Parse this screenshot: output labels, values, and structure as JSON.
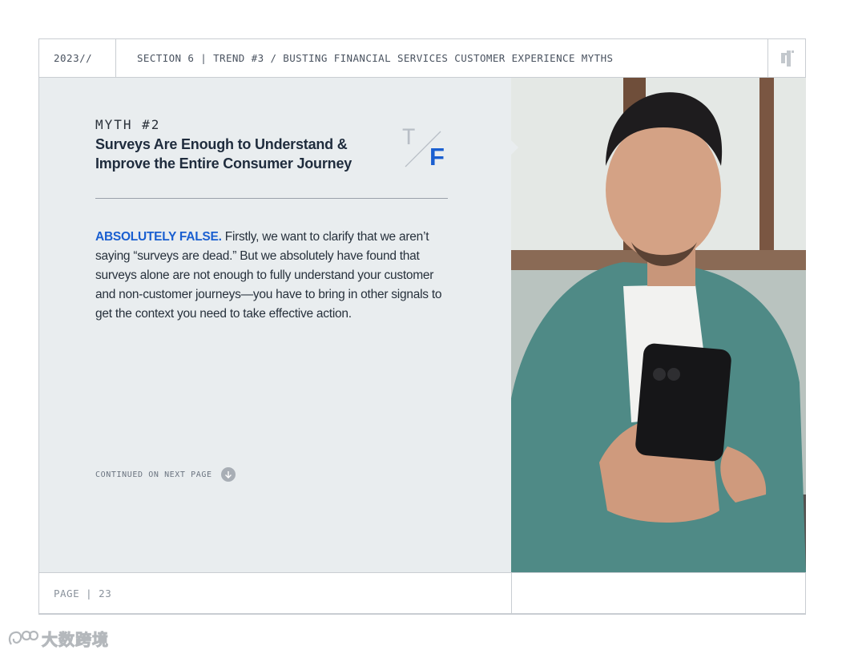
{
  "header": {
    "year": "2023//",
    "section": "SECTION 6 | TREND #3 / BUSTING FINANCIAL SERVICES CUSTOMER EXPERIENCE MYTHS",
    "logo_icon": "brand-logo-icon"
  },
  "myth": {
    "label": "MYTH #2",
    "title": "Surveys Are Enough to Understand & Improve the Entire Consumer Journey",
    "true_letter": "T",
    "false_letter": "F"
  },
  "body": {
    "lead": "ABSOLUTELY FALSE.",
    "text": " Firstly, we want to clarify that we aren’t saying “surveys are dead.” But we absolutely have found that surveys alone are not enough to fully understand your customer and non-customer journeys—you have to bring in other signals to get the context you need to take effective action."
  },
  "continued": {
    "label": "CONTINUED ON NEXT PAGE",
    "icon": "arrow-down-circle-icon"
  },
  "footer": {
    "page": "PAGE | 23"
  },
  "watermark": {
    "text": "大数跨境"
  },
  "colors": {
    "accent_blue": "#1a5fd0",
    "panel_bg": "#e9edef",
    "title_navy": "#1f2c3d"
  }
}
